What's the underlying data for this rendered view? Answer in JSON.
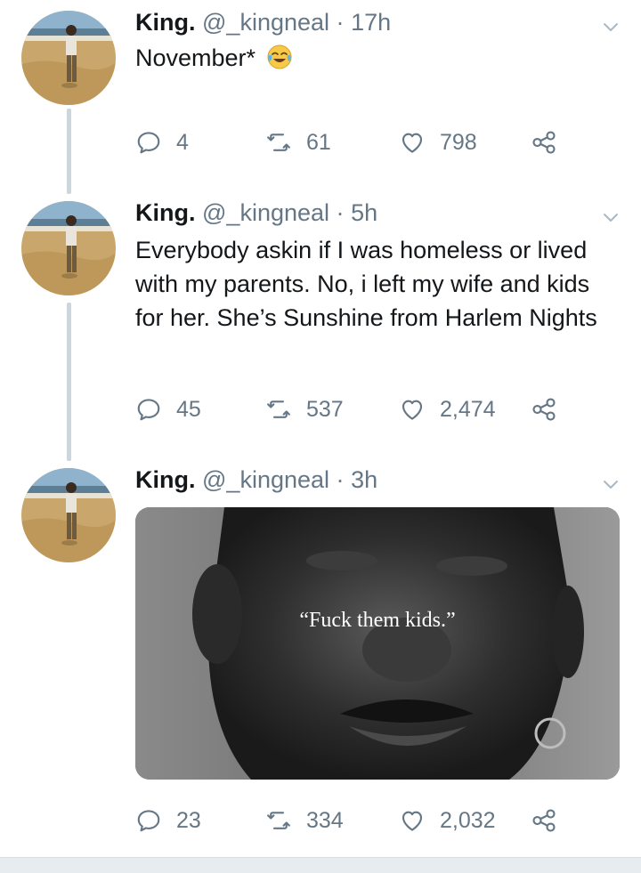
{
  "author": {
    "name": "King.",
    "handle": "@_kingneal"
  },
  "separator": "·",
  "colors": {
    "text": "#14171a",
    "secondary": "#657786",
    "thread_line": "#ccd6dd"
  },
  "tweets": [
    {
      "time": "17h",
      "text": "November*",
      "emoji": "face-with-tears-of-joy-emoji",
      "actions": {
        "replies": "4",
        "retweets": "61",
        "likes": "798"
      }
    },
    {
      "time": "5h",
      "text": "Everybody askin if I was homeless or lived with my parents. No, i left my wife and kids for her. She’s Sunshine from Harlem Nights",
      "actions": {
        "replies": "45",
        "retweets": "537",
        "likes": "2,474"
      }
    },
    {
      "time": "3h",
      "media": {
        "caption": "“Fuck them kids.”"
      },
      "actions": {
        "replies": "23",
        "retweets": "334",
        "likes": "2,032"
      }
    }
  ]
}
